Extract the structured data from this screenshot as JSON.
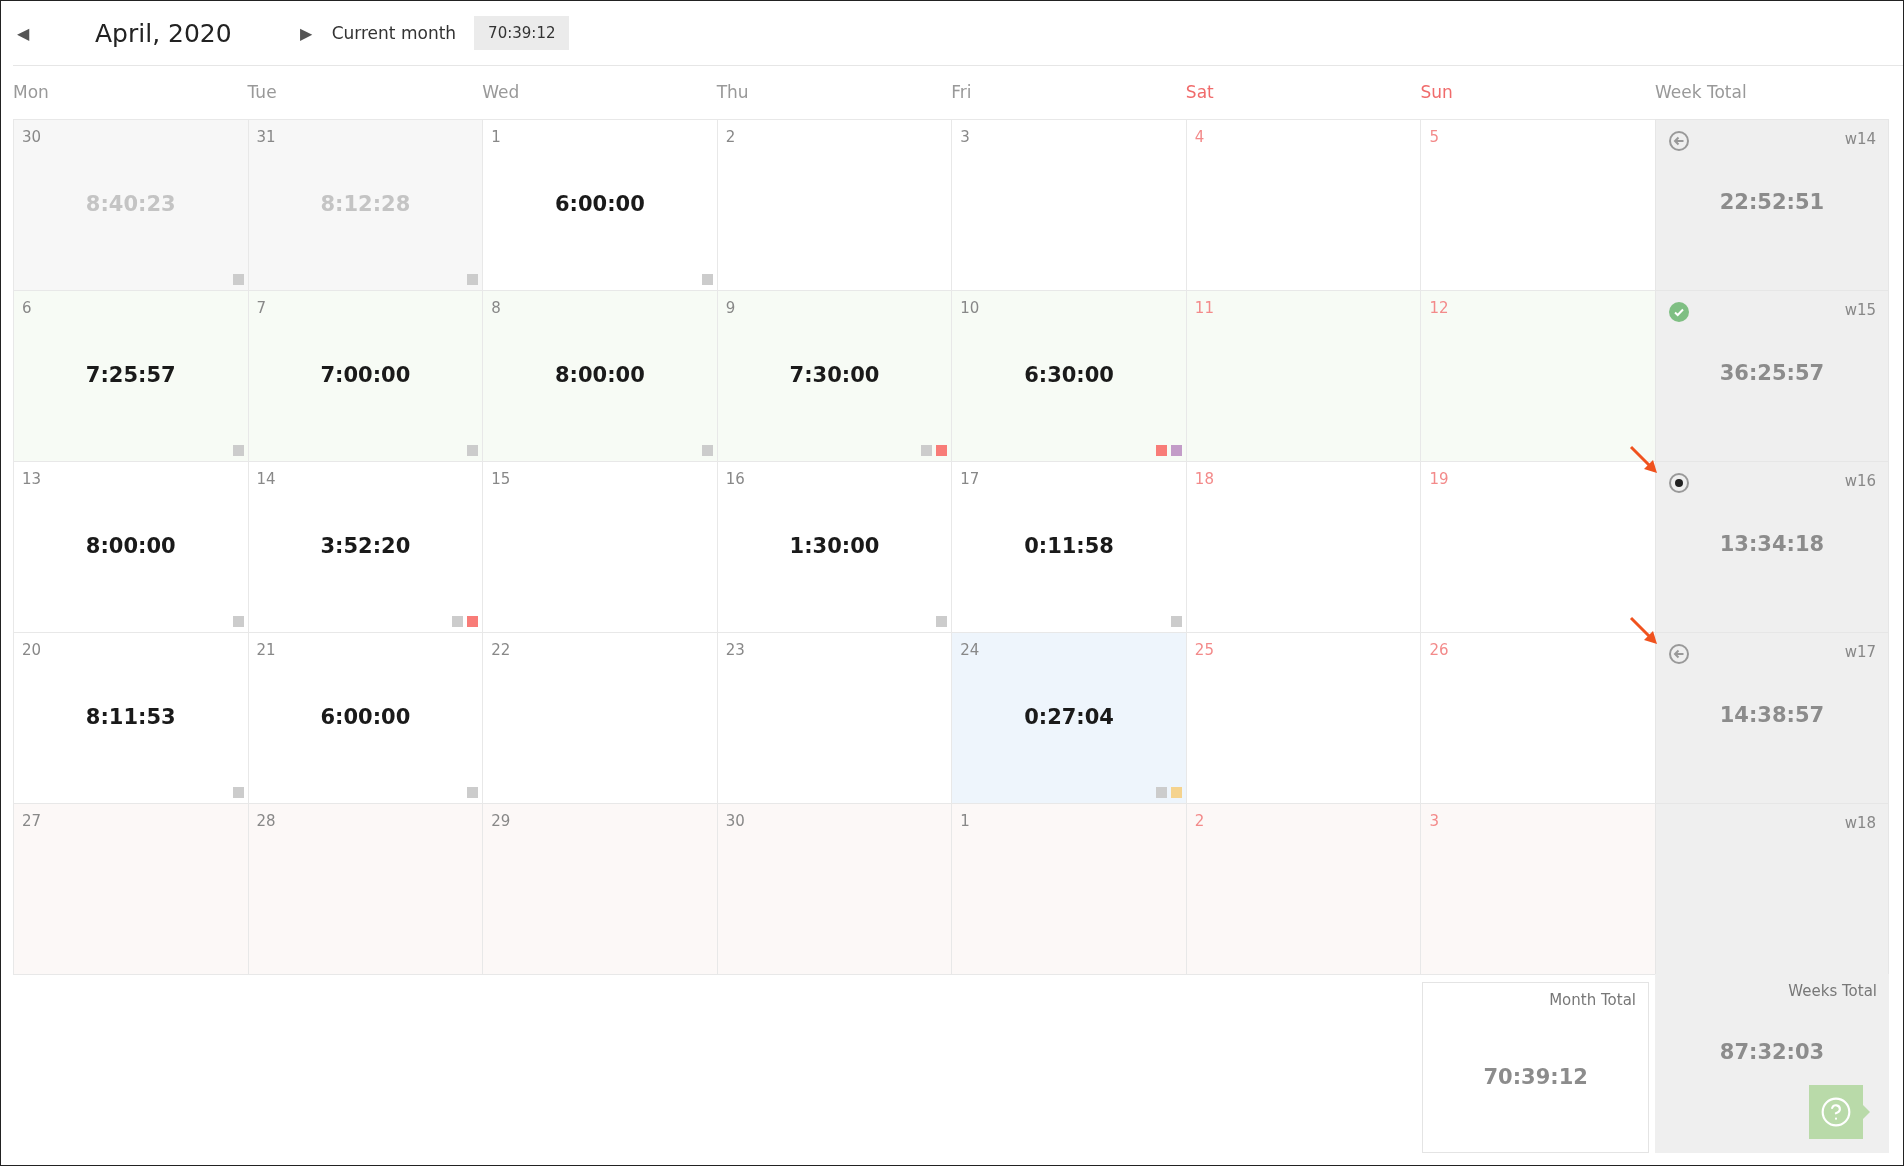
{
  "header": {
    "prev": "◀",
    "title": "April, 2020",
    "next": "▶",
    "current_month": "Current month",
    "badge": "70:39:12"
  },
  "columns": [
    {
      "label": "Mon",
      "weekend": false
    },
    {
      "label": "Tue",
      "weekend": false
    },
    {
      "label": "Wed",
      "weekend": false
    },
    {
      "label": "Thu",
      "weekend": false
    },
    {
      "label": "Fri",
      "weekend": false
    },
    {
      "label": "Sat",
      "weekend": true
    },
    {
      "label": "Sun",
      "weekend": true
    },
    {
      "label": "Week Total",
      "weekend": false
    }
  ],
  "weeks": [
    {
      "label": "w14",
      "kind": "returned",
      "marked": false,
      "total": "22:52:51",
      "days": [
        {
          "date": "30",
          "kind": "outside",
          "weekend": false,
          "time": "8:40:23",
          "tags": [
            {
              "color": "#cccccc"
            }
          ]
        },
        {
          "date": "31",
          "kind": "outside",
          "weekend": false,
          "time": "8:12:28",
          "tags": [
            {
              "color": "#cccccc"
            }
          ]
        },
        {
          "date": "1",
          "kind": "plain",
          "weekend": false,
          "time": "6:00:00",
          "tags": [
            {
              "color": "#cccccc"
            }
          ]
        },
        {
          "date": "2",
          "kind": "plain",
          "weekend": false
        },
        {
          "date": "3",
          "kind": "plain",
          "weekend": false
        },
        {
          "date": "4",
          "kind": "plain",
          "weekend": true
        },
        {
          "date": "5",
          "kind": "plain",
          "weekend": true
        }
      ]
    },
    {
      "label": "w15",
      "kind": "approved",
      "marked": false,
      "total": "36:25:57",
      "days": [
        {
          "date": "6",
          "kind": "approved",
          "weekend": false,
          "time": "7:25:57",
          "tags": [
            {
              "color": "#cccccc"
            }
          ]
        },
        {
          "date": "7",
          "kind": "approved",
          "weekend": false,
          "time": "7:00:00",
          "tags": [
            {
              "color": "#cccccc"
            }
          ]
        },
        {
          "date": "8",
          "kind": "approved",
          "weekend": false,
          "time": "8:00:00",
          "tags": [
            {
              "color": "#cccccc"
            }
          ]
        },
        {
          "date": "9",
          "kind": "approved",
          "weekend": false,
          "time": "7:30:00",
          "tags": [
            {
              "color": "#cccccc"
            },
            {
              "color": "#f87c78"
            }
          ]
        },
        {
          "date": "10",
          "kind": "approved",
          "weekend": false,
          "time": "6:30:00",
          "tags": [
            {
              "color": "#f87c78"
            },
            {
              "color": "#c39cc8"
            }
          ]
        },
        {
          "date": "11",
          "kind": "approved",
          "weekend": true
        },
        {
          "date": "12",
          "kind": "approved",
          "weekend": true
        }
      ]
    },
    {
      "label": "w16",
      "kind": "open",
      "marked": true,
      "total": "13:34:18",
      "days": [
        {
          "date": "13",
          "kind": "plain",
          "weekend": false,
          "time": "8:00:00",
          "tags": [
            {
              "color": "#cccccc"
            }
          ]
        },
        {
          "date": "14",
          "kind": "plain",
          "weekend": false,
          "time": "3:52:20",
          "tags": [
            {
              "color": "#cccccc"
            },
            {
              "color": "#f87c78"
            }
          ]
        },
        {
          "date": "15",
          "kind": "plain",
          "weekend": false
        },
        {
          "date": "16",
          "kind": "plain",
          "weekend": false,
          "time": "1:30:00",
          "tags": [
            {
              "color": "#cccccc"
            }
          ]
        },
        {
          "date": "17",
          "kind": "plain",
          "weekend": false,
          "time": "0:11:58",
          "tags": [
            {
              "color": "#cccccc"
            }
          ]
        },
        {
          "date": "18",
          "kind": "plain",
          "weekend": true
        },
        {
          "date": "19",
          "kind": "plain",
          "weekend": true
        }
      ]
    },
    {
      "label": "w17",
      "kind": "returned",
      "marked": true,
      "total": "14:38:57",
      "days": [
        {
          "date": "20",
          "kind": "plain",
          "weekend": false,
          "time": "8:11:53",
          "tags": [
            {
              "color": "#cccccc"
            }
          ]
        },
        {
          "date": "21",
          "kind": "plain",
          "weekend": false,
          "time": "6:00:00",
          "tags": [
            {
              "color": "#cccccc"
            }
          ]
        },
        {
          "date": "22",
          "kind": "plain",
          "weekend": false
        },
        {
          "date": "23",
          "kind": "plain",
          "weekend": false
        },
        {
          "date": "24",
          "kind": "today",
          "weekend": false,
          "time": "0:27:04",
          "tags": [
            {
              "color": "#cccccc"
            },
            {
              "color": "#f5d38e"
            }
          ]
        },
        {
          "date": "25",
          "kind": "plain",
          "weekend": true
        },
        {
          "date": "26",
          "kind": "plain",
          "weekend": true
        }
      ]
    },
    {
      "label": "w18",
      "kind": "none",
      "marked": false,
      "days": [
        {
          "date": "27",
          "kind": "future",
          "weekend": false
        },
        {
          "date": "28",
          "kind": "future",
          "weekend": false
        },
        {
          "date": "29",
          "kind": "future",
          "weekend": false
        },
        {
          "date": "30",
          "kind": "future",
          "weekend": false
        },
        {
          "date": "1",
          "kind": "future",
          "weekend": false
        },
        {
          "date": "2",
          "kind": "future",
          "weekend": true
        },
        {
          "date": "3",
          "kind": "future",
          "weekend": true
        }
      ]
    }
  ],
  "month_total": {
    "label": "Month Total",
    "value": "70:39:12"
  },
  "weeks_total": {
    "label": "Weeks Total",
    "value": "87:32:03"
  }
}
